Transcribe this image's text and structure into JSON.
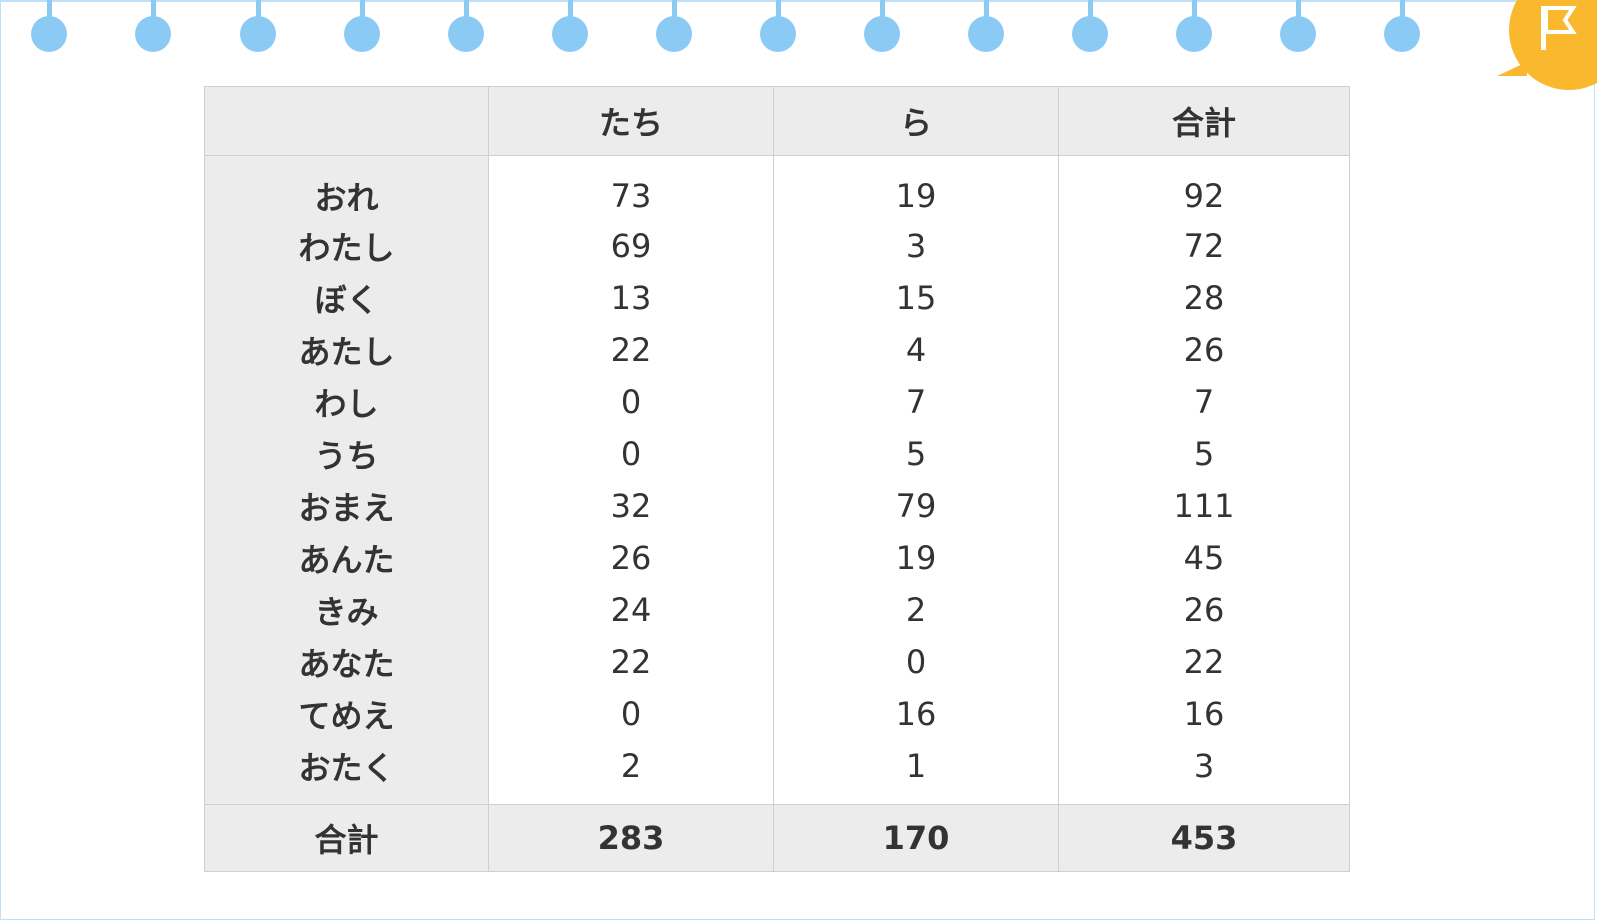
{
  "colors": {
    "ring": "#8ccaf6",
    "badge": "#f9b82e",
    "header_bg": "#ececec"
  },
  "badge": {
    "icon": "flag-icon"
  },
  "table": {
    "headers": [
      "",
      "たち",
      "ら",
      "合計"
    ],
    "rows": [
      [
        "おれ",
        "73",
        "19",
        "92"
      ],
      [
        "わたし",
        "69",
        "3",
        "72"
      ],
      [
        "ぼく",
        "13",
        "15",
        "28"
      ],
      [
        "あたし",
        "22",
        "4",
        "26"
      ],
      [
        "わし",
        "0",
        "7",
        "7"
      ],
      [
        "うち",
        "0",
        "5",
        "5"
      ],
      [
        "おまえ",
        "32",
        "79",
        "111"
      ],
      [
        "あんた",
        "26",
        "19",
        "45"
      ],
      [
        "きみ",
        "24",
        "2",
        "26"
      ],
      [
        "あなた",
        "22",
        "0",
        "22"
      ],
      [
        "てめえ",
        "0",
        "16",
        "16"
      ],
      [
        "おたく",
        "2",
        "1",
        "3"
      ]
    ],
    "footer": [
      "合計",
      "283",
      "170",
      "453"
    ]
  }
}
